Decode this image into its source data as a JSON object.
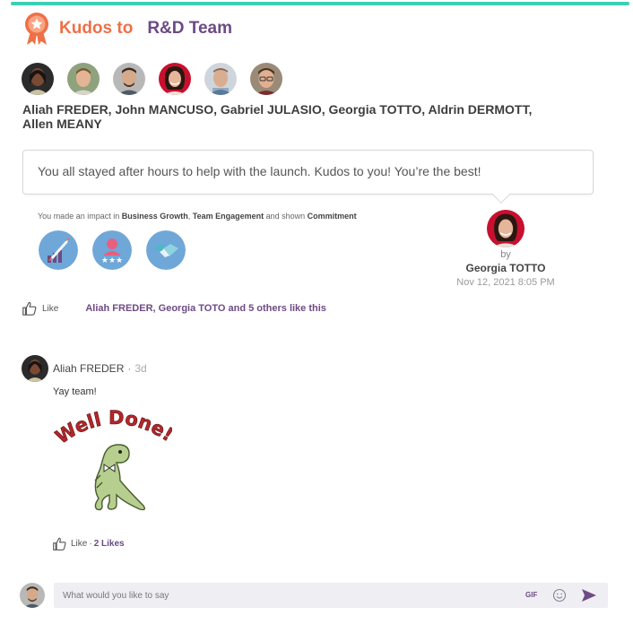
{
  "header": {
    "kudos_label": "Kudos to",
    "team_name": "R&D Team",
    "accent_color": "#ef7047",
    "team_color": "#6e4a84",
    "top_bar_color": "#3dcfb6"
  },
  "recipients": {
    "avatars": [
      "Aliah FREDER",
      "John MANCUSO",
      "Gabriel JULASIO",
      "Georgia TOTTO",
      "Aldrin DERMOTT",
      "Allen MEANY"
    ],
    "names_line": "Aliah FREDER, John MANCUSO, Gabriel JULASIO, Georgia TOTTO, Aldrin DERMOTT, Allen MEANY"
  },
  "message": "You all stayed after hours to help with the launch. Kudos to you! You’re the best!",
  "impact": {
    "prefix": "You made an impact in ",
    "value1": "Business Growth",
    "sep1": ", ",
    "value2": "Team Engagement",
    "mid": " and shown ",
    "value3": "Commitment",
    "icons": [
      "rocket-growth-icon",
      "team-star-icon",
      "handshake-icon"
    ]
  },
  "giver": {
    "by_label": "by",
    "name": "Georgia TOTTO",
    "date": "Nov 12, 2021 8:05 PM"
  },
  "likes": {
    "like_label": "Like",
    "likers_text": "Aliah FREDER, Georgia TOTO and 5 others like this"
  },
  "comment": {
    "author": "Aliah FREDER",
    "dot": "·",
    "age": "3d",
    "text": "Yay team!",
    "sticker_text": "Well Done!",
    "like_label": "Like",
    "sep": "·",
    "likes_count": "2 Likes"
  },
  "composer": {
    "placeholder": "What would you like to say",
    "gif_label": "GIF"
  }
}
